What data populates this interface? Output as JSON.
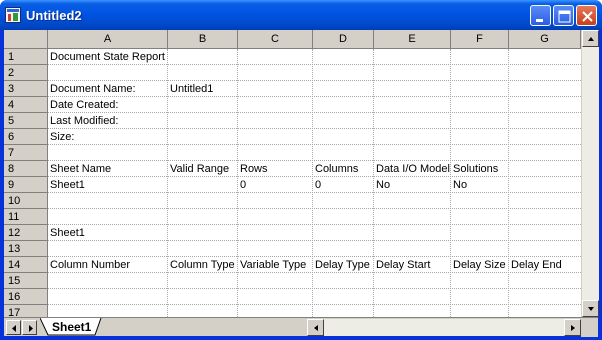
{
  "window": {
    "title": "Untitled2"
  },
  "columns": [
    "A",
    "B",
    "C",
    "D",
    "E",
    "F",
    "G"
  ],
  "rows": [
    "1",
    "2",
    "3",
    "4",
    "5",
    "6",
    "7",
    "8",
    "9",
    "10",
    "11",
    "12",
    "13",
    "14",
    "15",
    "16",
    "17"
  ],
  "cells": {
    "r1": [
      "Document State Report",
      "",
      "",
      "",
      "",
      "",
      ""
    ],
    "r3": [
      "Document Name:",
      "Untitled1",
      "",
      "",
      "",
      "",
      ""
    ],
    "r4": [
      "Date Created:",
      "",
      "",
      "",
      "",
      "",
      ""
    ],
    "r5": [
      "Last Modified:",
      "",
      "",
      "",
      "",
      "",
      ""
    ],
    "r6": [
      "Size:",
      "",
      "",
      "",
      "",
      "",
      ""
    ],
    "r8": [
      "Sheet Name",
      "Valid Range",
      "Rows",
      "Columns",
      "Data I/O Model",
      "Solutions",
      ""
    ],
    "r9": [
      "Sheet1",
      "",
      "0",
      "0",
      "No",
      "No",
      ""
    ],
    "r12": [
      "Sheet1",
      "",
      "",
      "",
      "",
      "",
      ""
    ],
    "r14": [
      "Column Number",
      "Column Type",
      "Variable Type",
      "Delay Type",
      "Delay Start",
      "Delay Size",
      "Delay End"
    ]
  },
  "sheet_tab": {
    "label": "Sheet1"
  },
  "colors": {
    "title_bar": "#0054e3",
    "header_bg": "#d4d0c8",
    "close_button": "#c6401c"
  },
  "icons": [
    "app-icon",
    "minimize-icon",
    "maximize-icon",
    "close-icon",
    "scroll-up-icon",
    "scroll-down-icon",
    "scroll-left-icon",
    "scroll-right-icon",
    "tab-first-icon",
    "tab-last-icon"
  ]
}
